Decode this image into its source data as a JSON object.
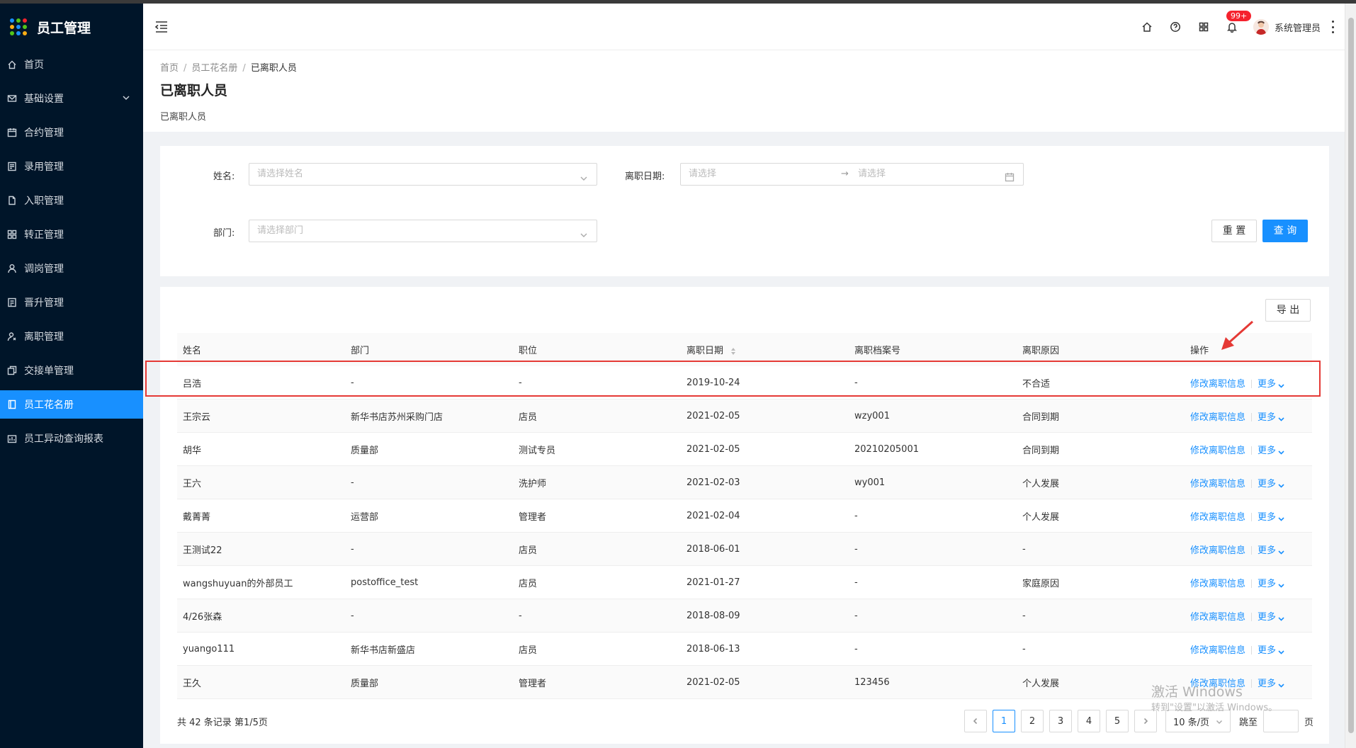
{
  "app": {
    "title": "员工管理"
  },
  "sidebar": {
    "items": [
      {
        "label": "首页",
        "icon": "home-icon"
      },
      {
        "label": "基础设置",
        "icon": "mail-icon",
        "expandable": true
      },
      {
        "label": "合约管理",
        "icon": "calendar-icon"
      },
      {
        "label": "录用管理",
        "icon": "form-icon"
      },
      {
        "label": "入职管理",
        "icon": "file-icon"
      },
      {
        "label": "转正管理",
        "icon": "grid-icon"
      },
      {
        "label": "调岗管理",
        "icon": "user-icon"
      },
      {
        "label": "晋升管理",
        "icon": "document-icon"
      },
      {
        "label": "离职管理",
        "icon": "user-leave-icon"
      },
      {
        "label": "交接单管理",
        "icon": "copy-icon"
      },
      {
        "label": "员工花名册",
        "icon": "book-icon",
        "active": true
      },
      {
        "label": "员工异动查询报表",
        "icon": "report-icon"
      }
    ]
  },
  "header": {
    "notification_badge": "99+",
    "username": "系统管理员",
    "icons": [
      "home-icon",
      "help-icon",
      "apps-icon",
      "bell-icon"
    ]
  },
  "breadcrumb": {
    "home": "首页",
    "parent": "员工花名册",
    "current": "已离职人员"
  },
  "page": {
    "title": "已离职人员",
    "subtitle": "已离职人员"
  },
  "filters": {
    "name_label": "姓名:",
    "name_placeholder": "请选择姓名",
    "date_label": "离职日期:",
    "date_start_placeholder": "请选择",
    "date_end_placeholder": "请选择",
    "date_sep": "→",
    "dept_label": "部门:",
    "dept_placeholder": "请选择部门",
    "reset_label": "重 置",
    "query_label": "查 询"
  },
  "table": {
    "export_label": "导 出",
    "columns": [
      "姓名",
      "部门",
      "职位",
      "离职日期",
      "离职档案号",
      "离职原因",
      "操作"
    ],
    "action_edit": "修改离职信息",
    "action_more": "更多",
    "rows": [
      [
        "吕浩",
        "-",
        "-",
        "2019-10-24",
        "-",
        "不合适"
      ],
      [
        "王宗云",
        "新华书店苏州采购门店",
        "店员",
        "2021-02-05",
        "wzy001",
        "合同到期"
      ],
      [
        "胡华",
        "质量部",
        "测试专员",
        "2021-02-05",
        "20210205001",
        "合同到期"
      ],
      [
        "王六",
        "-",
        "洗护师",
        "2021-02-03",
        "wy001",
        "个人发展"
      ],
      [
        "戴菁菁",
        "运营部",
        "管理者",
        "2021-02-04",
        "-",
        "个人发展"
      ],
      [
        "王测试22",
        "-",
        "店员",
        "2018-06-01",
        "-",
        "-"
      ],
      [
        "wangshuyuan的外部员工",
        "postoffice_test",
        "店员",
        "2021-01-27",
        "-",
        "家庭原因"
      ],
      [
        "4/26张森",
        "-",
        "-",
        "2018-08-09",
        "-",
        "-"
      ],
      [
        "yuango111",
        "新华书店新盛店",
        "店员",
        "2018-06-13",
        "-",
        "-"
      ],
      [
        "王久",
        "质量部",
        "管理者",
        "2021-02-05",
        "123456",
        "个人发展"
      ]
    ]
  },
  "pagination": {
    "total_text": "共 42 条记录 第1/5页",
    "pages": [
      "1",
      "2",
      "3",
      "4",
      "5"
    ],
    "current_page": "1",
    "page_size": "10 条/页",
    "jump_label": "跳至",
    "page_suffix": "页"
  },
  "watermark": {
    "line1": "激活 Windows",
    "line2": "转到\"设置\"以激活 Windows。"
  },
  "colors": {
    "sidebar_bg": "#001529",
    "accent": "#1890ff",
    "highlight": "#e53935"
  }
}
